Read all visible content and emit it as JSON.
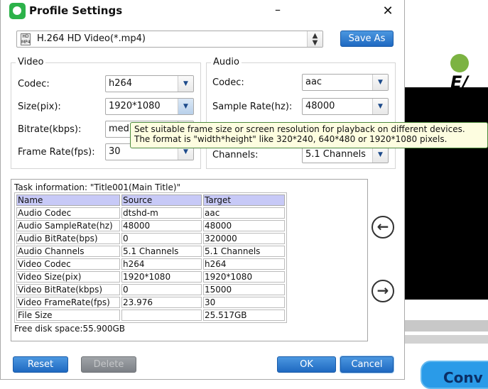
{
  "title": "Profile Settings",
  "profile": {
    "value": "H.264 HD Video(*.mp4)",
    "icon": "hd-mp4-icon"
  },
  "save_as": "Save As",
  "video": {
    "label": "Video",
    "codec_label": "Codec:",
    "codec": "h264",
    "size_label": "Size(pix):",
    "size": "1920*1080",
    "bitrate_label": "Bitrate(kbps):",
    "bitrate": "medium",
    "framerate_label": "Frame Rate(fps):",
    "framerate": "30"
  },
  "audio": {
    "label": "Audio",
    "codec_label": "Codec:",
    "codec": "aac",
    "samplerate_label": "Sample Rate(hz):",
    "samplerate": "48000",
    "channels_label": "Channels:",
    "channels": "5.1 Channels"
  },
  "tooltip": {
    "line1": "Set suitable frame size or screen resolution for playback on different devices.",
    "line2": "The format is \"width*height\" like 320*240, 640*480 or 1920*1080 pixels."
  },
  "task": {
    "title": "Task information: \"Title001(Main Title)\"",
    "headers": [
      "Name",
      "Source",
      "Target"
    ],
    "rows": [
      [
        "Audio Codec",
        "dtshd-m",
        "aac"
      ],
      [
        "Audio SampleRate(hz)",
        "48000",
        "48000"
      ],
      [
        "Audio BitRate(bps)",
        "0",
        "320000"
      ],
      [
        "Audio Channels",
        "5.1 Channels",
        "5.1 Channels"
      ],
      [
        "Video Codec",
        "h264",
        "h264"
      ],
      [
        "Video Size(pix)",
        "1920*1080",
        "1920*1080"
      ],
      [
        "Video BitRate(kbps)",
        "0",
        "15000"
      ],
      [
        "Video FrameRate(fps)",
        "23.976",
        "30"
      ],
      [
        "File Size",
        "",
        "25.517GB"
      ]
    ],
    "free_space": "Free disk space:55.900GB"
  },
  "buttons": {
    "reset": "Reset",
    "delete": "Delete",
    "ok": "OK",
    "cancel": "Cancel"
  },
  "background": {
    "logo_text": "E/",
    "convert_text": "Conv"
  },
  "colors": {
    "accent": "#1f69c1",
    "header_row": "#c7c9f7",
    "tooltip_bg": "#fdfde0"
  }
}
